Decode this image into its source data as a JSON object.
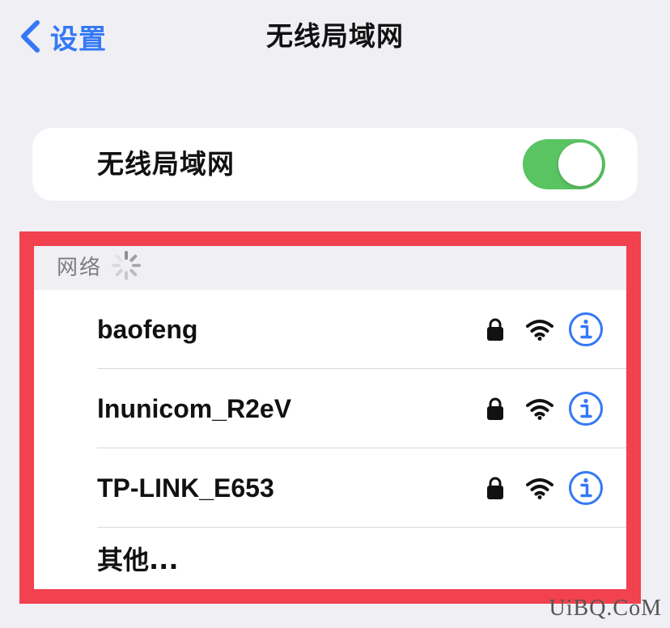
{
  "navbar": {
    "back_label": "设置",
    "title": "无线局域网"
  },
  "wifi_toggle": {
    "label": "无线局域网",
    "on": true
  },
  "networks_section": {
    "header": "网络",
    "items": [
      {
        "name": "baofeng",
        "locked": true
      },
      {
        "name": "lnunicom_R2eV",
        "locked": true
      },
      {
        "name": "TP-LINK_E653",
        "locked": true
      }
    ],
    "other_label": "其他..."
  },
  "watermark": "UiBQ.CoM",
  "colors": {
    "accent_blue": "#3478f6",
    "toggle_green": "#5ac362",
    "highlight_red": "#f2414f",
    "background": "#efeff4"
  }
}
